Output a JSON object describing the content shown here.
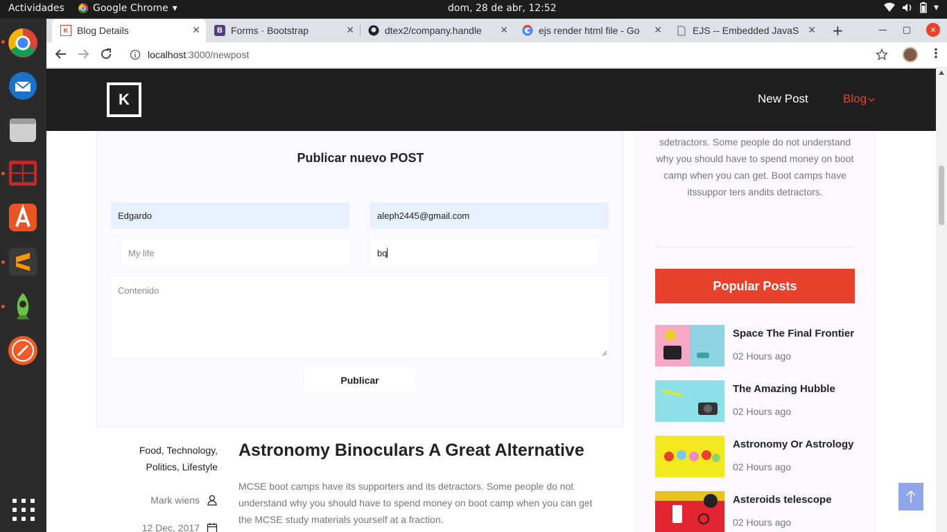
{
  "system_bar": {
    "activities": "Actividades",
    "app_name": "Google Chrome",
    "clock": "dom, 28 de abr, 12:52"
  },
  "dock": {
    "apps": [
      "Google Chrome",
      "Thunderbird",
      "Files",
      "Terminal",
      "Ubuntu Software",
      "Sublime Text",
      "Rocket",
      "Postman"
    ]
  },
  "browser": {
    "tabs": [
      {
        "title": "Blog Details",
        "icon": "k-logo-icon"
      },
      {
        "title": "Forms · Bootstrap",
        "icon": "bootstrap-icon"
      },
      {
        "title": "dtex2/company.handle",
        "icon": "github-icon"
      },
      {
        "title": "ejs render html file - Go",
        "icon": "google-icon"
      },
      {
        "title": "EJS -- Embedded JavaS",
        "icon": "page-icon"
      }
    ],
    "url_host": "localhost",
    "url_path": ":3000/newpost"
  },
  "site": {
    "logo": "K",
    "nav": {
      "new_post": "New Post",
      "blog": "Blog"
    },
    "form": {
      "title": "Publicar nuevo POST",
      "name_value": "Edgardo",
      "email_value": "aleph2445@gmail.com",
      "subject_placeholder": "My life",
      "tags_value": "bq",
      "content_placeholder": "Contenido",
      "submit_label": "Publicar"
    },
    "sidebar": {
      "about_text": "sdetractors. Some people do not understand why you should have to spend money on boot camp when you can get. Boot camps have itssuppor ters andits detractors.",
      "popular_title": "Popular Posts",
      "posts": [
        {
          "title": "Space The Final Frontier",
          "date": "02 Hours ago"
        },
        {
          "title": "The Amazing Hubble",
          "date": "02 Hours ago"
        },
        {
          "title": "Astronomy Or Astrology",
          "date": "02 Hours ago"
        },
        {
          "title": "Asteroids telescope",
          "date": "02 Hours ago"
        }
      ]
    },
    "article": {
      "categories_line1": "Food, Technology,",
      "categories_line2": "Politics, Lifestyle",
      "title": "Astronomy Binoculars A Great Alternative",
      "body": "MCSE boot camps have its supporters and its detractors. Some people do not understand why you should have to spend money on boot camp when you can get the MCSE study materials yourself at a fraction.",
      "author": "Mark wiens",
      "date": "12 Dec, 2017"
    }
  },
  "colors": {
    "accent": "#e8412c",
    "header_bg": "#1f1f1f",
    "autofill": "#e8f0fe"
  }
}
